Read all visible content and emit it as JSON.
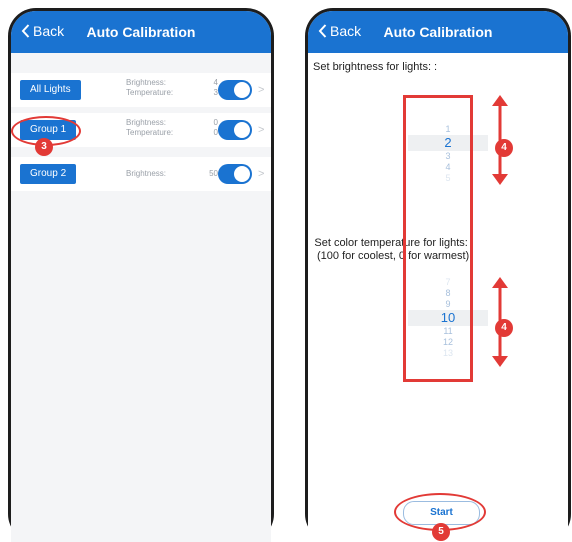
{
  "left": {
    "nav": {
      "back_label": "Back",
      "title": "Auto Calibration"
    },
    "groups": [
      {
        "name": "All Lights",
        "brightness_label": "Brightness:",
        "brightness": "4",
        "temperature_label": "Temperature:",
        "temperature": "3"
      },
      {
        "name": "Group 1",
        "brightness_label": "Brightness:",
        "brightness": "0",
        "temperature_label": "Temperature:",
        "temperature": "0"
      },
      {
        "name": "Group 2",
        "brightness_label": "Brightness:",
        "brightness": "50"
      }
    ],
    "callout": "3"
  },
  "right": {
    "nav": {
      "back_label": "Back",
      "title": "Auto Calibration"
    },
    "brightness_label": "Set brightness for lights: :",
    "brightness_picker": [
      "1",
      "2",
      "3",
      "4",
      "5"
    ],
    "brightness_selected": "2",
    "temperature_label_line1": "Set color temperature for lights:",
    "temperature_label_line2": "(100 for coolest, 0 for warmest)",
    "temperature_picker": [
      "7",
      "8",
      "9",
      "10",
      "11",
      "12",
      "13"
    ],
    "temperature_selected": "10",
    "callout_picker": "4",
    "start_label": "Start",
    "callout_start": "5"
  },
  "colors": {
    "accent": "#1a73d1",
    "callout": "#e23a36"
  }
}
